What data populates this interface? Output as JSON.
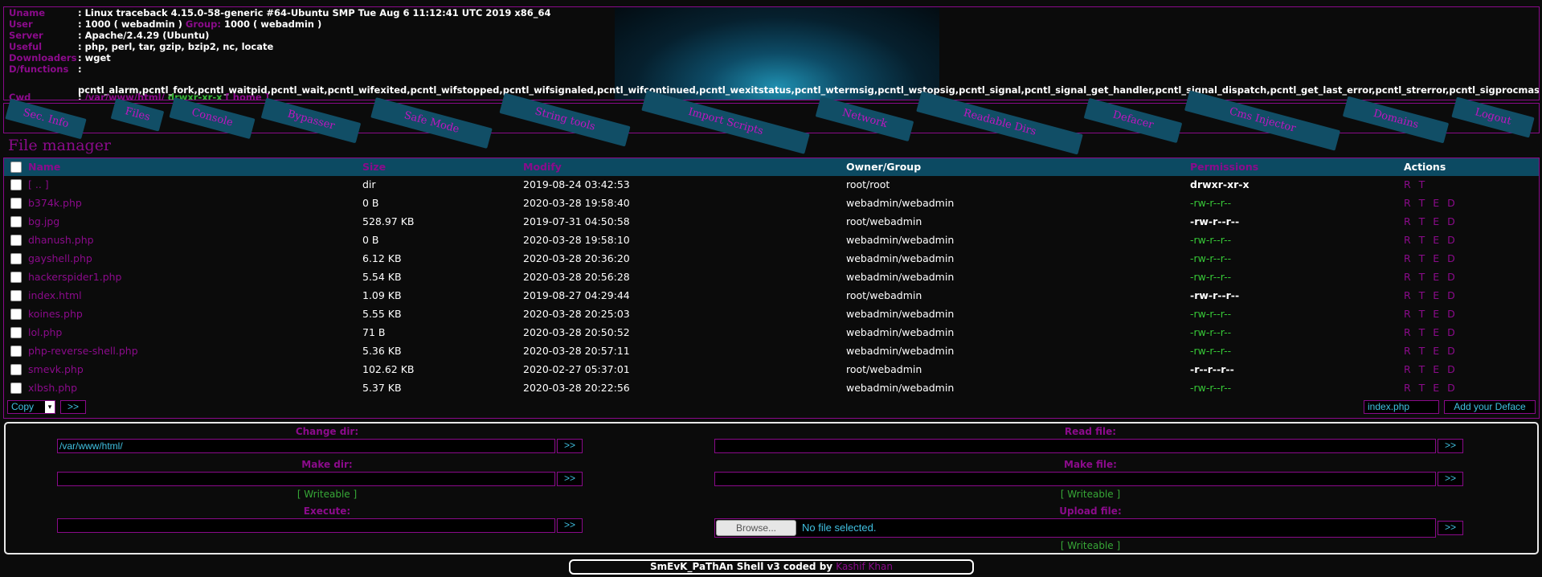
{
  "sysinfo": {
    "uname_label": "Uname",
    "uname": ": Linux traceback 4.15.0-58-generic #64-Ubuntu SMP Tue Aug 6 11:12:41 UTC 2019 x86_64",
    "user_label": "User",
    "user_prefix": ": 1000 ( webadmin ) ",
    "group_label": "Group:",
    "group_value": " 1000 ( webadmin )",
    "server_label": "Server",
    "server": ": Apache/2.4.29 (Ubuntu)",
    "useful_label": "Useful",
    "useful": ": php, perl, tar, gzip, bzip2, nc, locate",
    "downloaders_label": "Downloaders",
    "downloaders": ": wget",
    "dfunctions_label": "D/functions",
    "dfunctions_colon": ":",
    "dfunctions": "pcntl_alarm,pcntl_fork,pcntl_waitpid,pcntl_wait,pcntl_wifexited,pcntl_wifstopped,pcntl_wifsignaled,pcntl_wifcontinued,pcntl_wexitstatus,pcntl_wtermsig,pcntl_wstopsig,pcntl_signal,pcntl_signal_get_handler,pcntl_signal_dispatch,pcntl_get_last_error,pcntl_strerror,pcntl_sigprocmask,pcntl_si",
    "cwd_label": "Cwd",
    "cwd_colon": ": ",
    "cwd_path": "/var/www/html/",
    "cwd_perms": "drwxr-xr-x",
    "cwd_home": "[ home ]"
  },
  "menu": {
    "items": [
      "Sec. Info",
      "Files",
      "Console",
      "Bypasser",
      "Safe Mode",
      "String tools",
      "Import Scripts",
      "Network",
      "Readable Dirs",
      "Defacer",
      "Cms Injector",
      "Domains",
      "Logout"
    ]
  },
  "file_manager": {
    "title": "File manager",
    "headers": {
      "name": "Name",
      "size": "Size",
      "modify": "Modify",
      "owner": "Owner/Group",
      "permissions": "Permissions",
      "actions": "Actions"
    },
    "rows": [
      {
        "name": "[ .. ]",
        "size": "dir",
        "modify": "2019-08-24 03:42:53",
        "owner": "root/root",
        "perms": "drwxr-xr-x",
        "perm_color": "white",
        "actions": "R T"
      },
      {
        "name": "b374k.php",
        "size": "0 B",
        "modify": "2020-03-28 19:58:40",
        "owner": "webadmin/webadmin",
        "perms": "-rw-r--r--",
        "perm_color": "green",
        "actions": "R T E D"
      },
      {
        "name": "bg.jpg",
        "size": "528.97 KB",
        "modify": "2019-07-31 04:50:58",
        "owner": "root/webadmin",
        "perms": "-rw-r--r--",
        "perm_color": "white",
        "actions": "R T E D"
      },
      {
        "name": "dhanush.php",
        "size": "0 B",
        "modify": "2020-03-28 19:58:10",
        "owner": "webadmin/webadmin",
        "perms": "-rw-r--r--",
        "perm_color": "green",
        "actions": "R T E D"
      },
      {
        "name": "gayshell.php",
        "size": "6.12 KB",
        "modify": "2020-03-28 20:36:20",
        "owner": "webadmin/webadmin",
        "perms": "-rw-r--r--",
        "perm_color": "green",
        "actions": "R T E D"
      },
      {
        "name": "hackerspider1.php",
        "size": "5.54 KB",
        "modify": "2020-03-28 20:56:28",
        "owner": "webadmin/webadmin",
        "perms": "-rw-r--r--",
        "perm_color": "green",
        "actions": "R T E D"
      },
      {
        "name": "index.html",
        "size": "1.09 KB",
        "modify": "2019-08-27 04:29:44",
        "owner": "root/webadmin",
        "perms": "-rw-r--r--",
        "perm_color": "white",
        "actions": "R T E D"
      },
      {
        "name": "koines.php",
        "size": "5.55 KB",
        "modify": "2020-03-28 20:25:03",
        "owner": "webadmin/webadmin",
        "perms": "-rw-r--r--",
        "perm_color": "green",
        "actions": "R T E D"
      },
      {
        "name": "lol.php",
        "size": "71 B",
        "modify": "2020-03-28 20:50:52",
        "owner": "webadmin/webadmin",
        "perms": "-rw-r--r--",
        "perm_color": "green",
        "actions": "R T E D"
      },
      {
        "name": "php-reverse-shell.php",
        "size": "5.36 KB",
        "modify": "2020-03-28 20:57:11",
        "owner": "webadmin/webadmin",
        "perms": "-rw-r--r--",
        "perm_color": "green",
        "actions": "R T E D"
      },
      {
        "name": "smevk.php",
        "size": "102.62 KB",
        "modify": "2020-02-27 05:37:01",
        "owner": "root/webadmin",
        "perms": "-r--r--r--",
        "perm_color": "white",
        "actions": "R T E D"
      },
      {
        "name": "xlbsh.php",
        "size": "5.37 KB",
        "modify": "2020-03-28 20:22:56",
        "owner": "webadmin/webadmin",
        "perms": "-rw-r--r--",
        "perm_color": "green",
        "actions": "R T E D"
      }
    ],
    "action_select": "Copy",
    "action_go": ">>",
    "deface_file": "index.php",
    "deface_button": "Add your Deface"
  },
  "tools": {
    "change_dir_label": "Change dir:",
    "change_dir_value": "/var/www/html/",
    "make_dir_label": "Make dir:",
    "writeable": "[ Writeable ]",
    "execute_label": "Execute:",
    "read_file_label": "Read file:",
    "make_file_label": "Make file:",
    "upload_file_label": "Upload file:",
    "browse_button": "Browse...",
    "no_file": "No file selected.",
    "go": ">>"
  },
  "footer": {
    "text": "SmEvK_PaThAn Shell v3 coded by ",
    "author": "Kashif Khan"
  },
  "colors": {
    "accent": "#8b0b8b",
    "header_bar": "#0c4a62",
    "menu_bg": "#114e66",
    "ok": "#37c837"
  }
}
